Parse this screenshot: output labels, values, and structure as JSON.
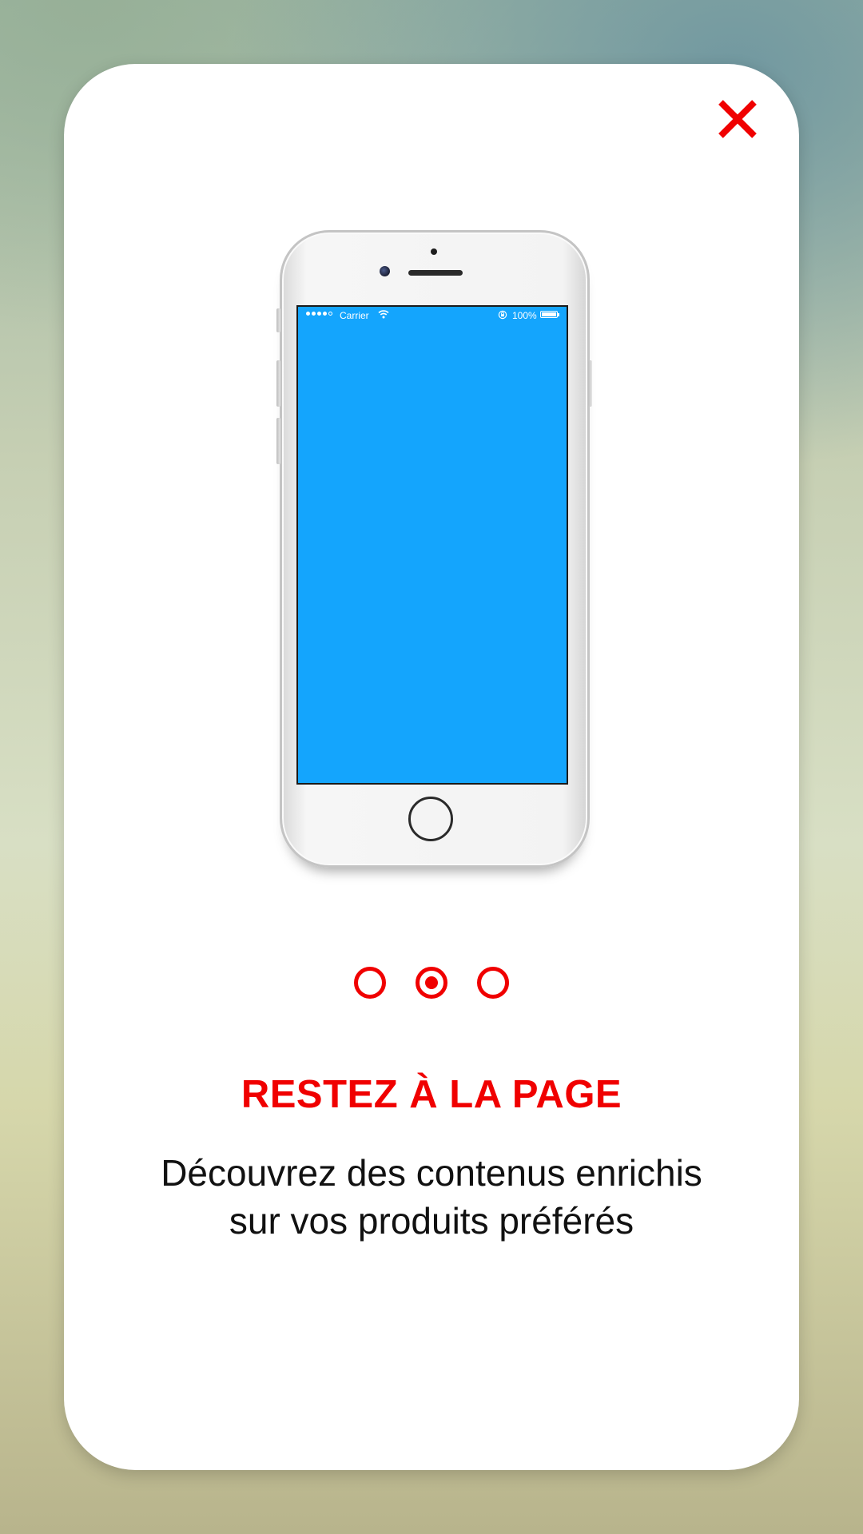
{
  "colors": {
    "accent": "#f00000",
    "phone_screen": "#14a5fd",
    "card": "#ffffff"
  },
  "close": {
    "icon": "close-icon"
  },
  "phone": {
    "carrier": "Carrier",
    "battery_text": "100%",
    "icons": [
      "signal-dots-icon",
      "wifi-icon",
      "rotation-lock-icon",
      "battery-icon",
      "home-button-icon"
    ]
  },
  "pager": {
    "count": 3,
    "active_index": 1
  },
  "onboarding": {
    "title": "RESTEZ À LA PAGE",
    "description": "Découvrez des contenus enrichis sur vos produits préférés"
  }
}
